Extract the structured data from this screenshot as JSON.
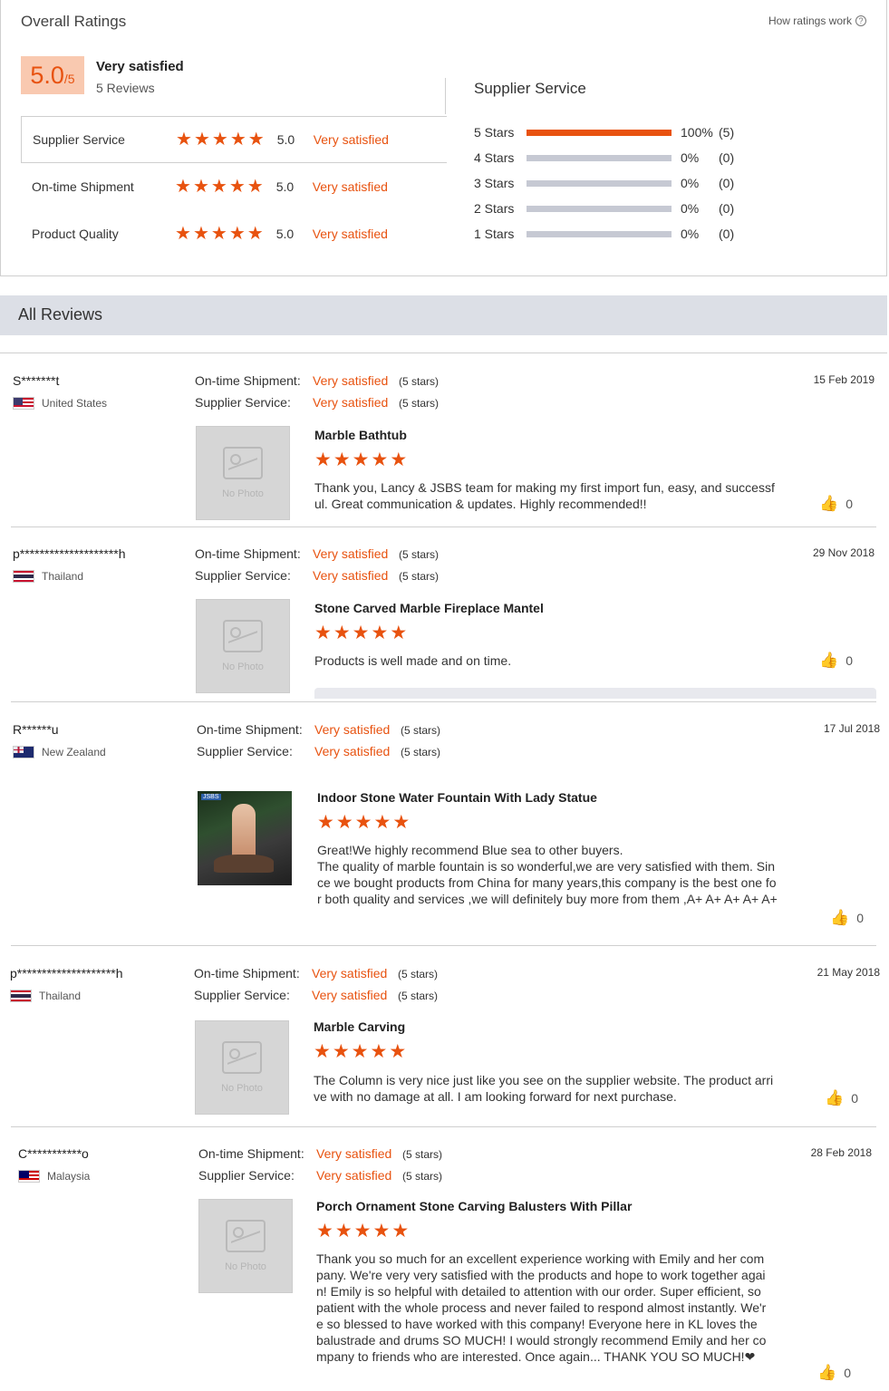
{
  "summary": {
    "title": "Overall Ratings",
    "how_link": "How ratings work",
    "help_glyph": "?",
    "score_main": "5.0",
    "score_sub": "/5",
    "overall_text": "Very satisfied",
    "review_count": "5 Reviews",
    "categories": [
      {
        "label": "Supplier Service",
        "rating": 5,
        "score": "5.0",
        "text": "Very satisfied"
      },
      {
        "label": "On-time Shipment",
        "rating": 5,
        "score": "5.0",
        "text": "Very satisfied"
      },
      {
        "label": "Product Quality",
        "rating": 5,
        "score": "5.0",
        "text": "Very satisfied"
      }
    ]
  },
  "breakdown": {
    "title": "Supplier Service",
    "rows": [
      {
        "label": "5  Stars",
        "fraction": 1.0,
        "pct": "100%",
        "count": "(5)"
      },
      {
        "label": "4  Stars",
        "fraction": 0,
        "pct": "0%",
        "count": "(0)"
      },
      {
        "label": "3  Stars",
        "fraction": 0,
        "pct": "0%",
        "count": "(0)"
      },
      {
        "label": "2  Stars",
        "fraction": 0,
        "pct": "0%",
        "count": "(0)"
      },
      {
        "label": "1  Stars",
        "fraction": 0,
        "pct": "0%",
        "count": "(0)"
      }
    ]
  },
  "all_reviews": {
    "title": "All Reviews"
  },
  "labels": {
    "shipment": "On-time Shipment:",
    "service": "Supplier Service:",
    "no_photo": "No Photo",
    "star_glyph": "★",
    "like_glyph": "👍",
    "photo_tag": "JSBS"
  },
  "reviews": [
    {
      "user": "S*******t",
      "country": "United States",
      "flag": "us",
      "date": "15 Feb 2019",
      "shipment_value": "Very satisfied",
      "shipment_stars": "(5 stars)",
      "service_value": "Very satisfied",
      "service_stars": "(5 stars)",
      "product": "Marble Bathtub",
      "rating": 5,
      "text": "Thank you, Lancy & JSBS team for making my first import fun, easy, and successful. Great communication & updates. Highly recommended!!",
      "likes": "0",
      "has_photo": false
    },
    {
      "user": "p********************h",
      "country": "Thailand",
      "flag": "th",
      "date": "29 Nov 2018",
      "shipment_value": "Very satisfied",
      "shipment_stars": "(5 stars)",
      "service_value": "Very satisfied",
      "service_stars": "(5 stars)",
      "product": "Stone Carved Marble Fireplace Mantel",
      "rating": 5,
      "text": "Products is well made and on time.",
      "likes": "0",
      "has_photo": false
    },
    {
      "user": "R******u",
      "country": "New Zealand",
      "flag": "nz",
      "date": "17 Jul 2018",
      "shipment_value": "Very satisfied",
      "shipment_stars": "(5 stars)",
      "service_value": "Very satisfied",
      "service_stars": "(5 stars)",
      "product": "Indoor Stone Water Fountain With Lady Statue",
      "rating": 5,
      "text": "Great!We highly recommend Blue sea to other buyers.\nThe quality of marble fountain is so wonderful,we are very satisfied with them. Since we bought products from China for many years,this company is the best one for both quality and services ,we will definitely buy more from them ,A+ A+ A+ A+ A+",
      "likes": "0",
      "has_photo": true
    },
    {
      "user": "p********************h",
      "country": "Thailand",
      "flag": "th",
      "date": "21 May 2018",
      "shipment_value": "Very satisfied",
      "shipment_stars": "(5 stars)",
      "service_value": "Very satisfied",
      "service_stars": "(5 stars)",
      "product": "Marble Carving",
      "rating": 5,
      "text": "The Column is very nice just like you see on the supplier website. The product arrive with no damage at all. I am looking forward for next purchase.",
      "likes": "0",
      "has_photo": false
    },
    {
      "user": "C***********o",
      "country": "Malaysia",
      "flag": "my",
      "date": "28 Feb 2018",
      "shipment_value": "Very satisfied",
      "shipment_stars": "(5 stars)",
      "service_value": "Very satisfied",
      "service_stars": "(5 stars)",
      "product": "Porch Ornament Stone Carving Balusters With Pillar",
      "rating": 5,
      "text": "Thank you so much for an excellent experience working with Emily and her company. We're very very satisfied with the products and hope to work together again! Emily is so helpful with detailed to attention with our order. Super efficient, so patient with the whole process and never failed to respond almost instantly. We're so blessed to have worked with this company! Everyone here in KL loves the balustrade and drums SO MUCH! I would strongly recommend Emily and her company to friends who are interested. Once again... THANK YOU SO MUCH!❤",
      "likes": "0",
      "has_photo": false
    }
  ],
  "colors": {
    "accent": "#e8520f",
    "badge_bg": "#f9c9b0",
    "header_bg": "#dcdfe6",
    "bar_empty": "#c6c9d3"
  }
}
